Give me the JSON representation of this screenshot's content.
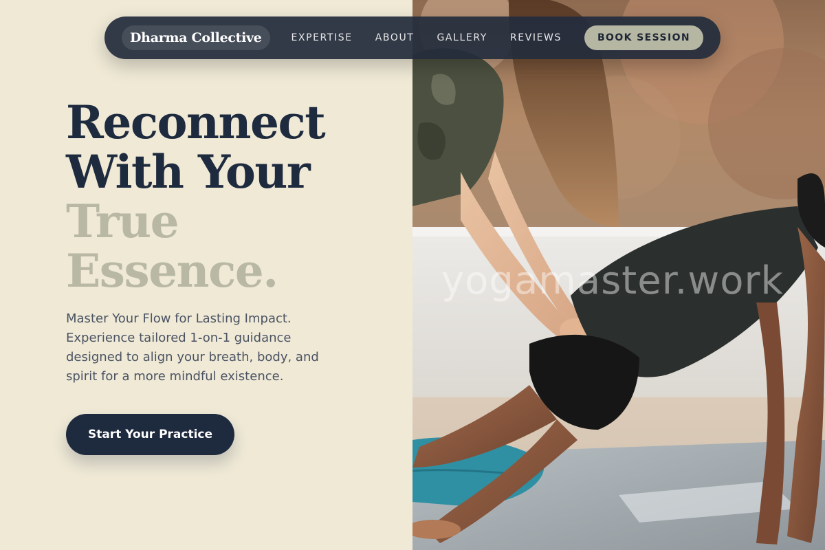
{
  "nav": {
    "brand": "Dharma Collective",
    "links": [
      "EXPERTISE",
      "ABOUT",
      "GALLERY",
      "REVIEWS"
    ],
    "cta_label": "BOOK SESSION"
  },
  "hero": {
    "headline_line1": "Reconnect",
    "headline_line2": "With Your",
    "headline_line3": "True",
    "headline_line4": "Essence.",
    "description": "Master Your Flow for Lasting Impact. Experience tailored 1-on-1 guidance designed to align your breath, body, and spirit for a more mindful existence.",
    "cta_label": "Start Your Practice"
  },
  "photo": {
    "watermark": "yogamaster.work"
  },
  "colors": {
    "background": "#efe9d6",
    "navy": "#1e2a3e",
    "muted_headline": "#b8b8a4",
    "nav_bg": "#242c3c",
    "book_button": "#b5b7a3"
  }
}
